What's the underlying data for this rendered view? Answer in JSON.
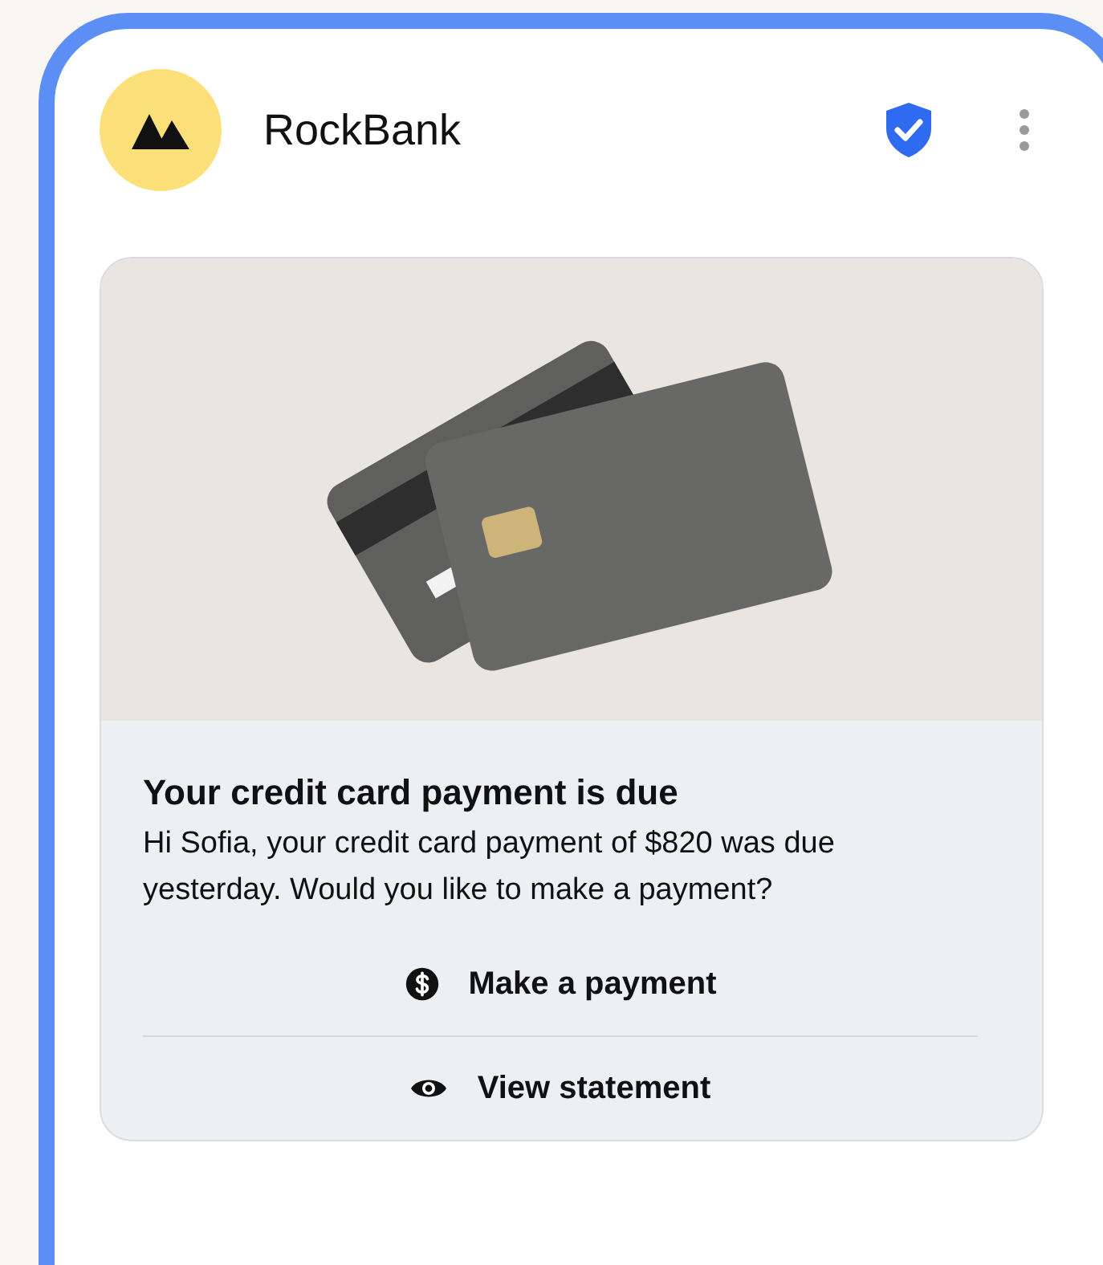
{
  "header": {
    "title": "RockBank"
  },
  "message": {
    "title": "Your credit card payment is due",
    "body": "Hi Sofia, your credit card payment of $820 was due yesterday. Would you like to make a payment?",
    "actions": [
      {
        "kind": "pay",
        "label": "Make a payment"
      },
      {
        "kind": "view",
        "label": "View statement"
      }
    ]
  }
}
